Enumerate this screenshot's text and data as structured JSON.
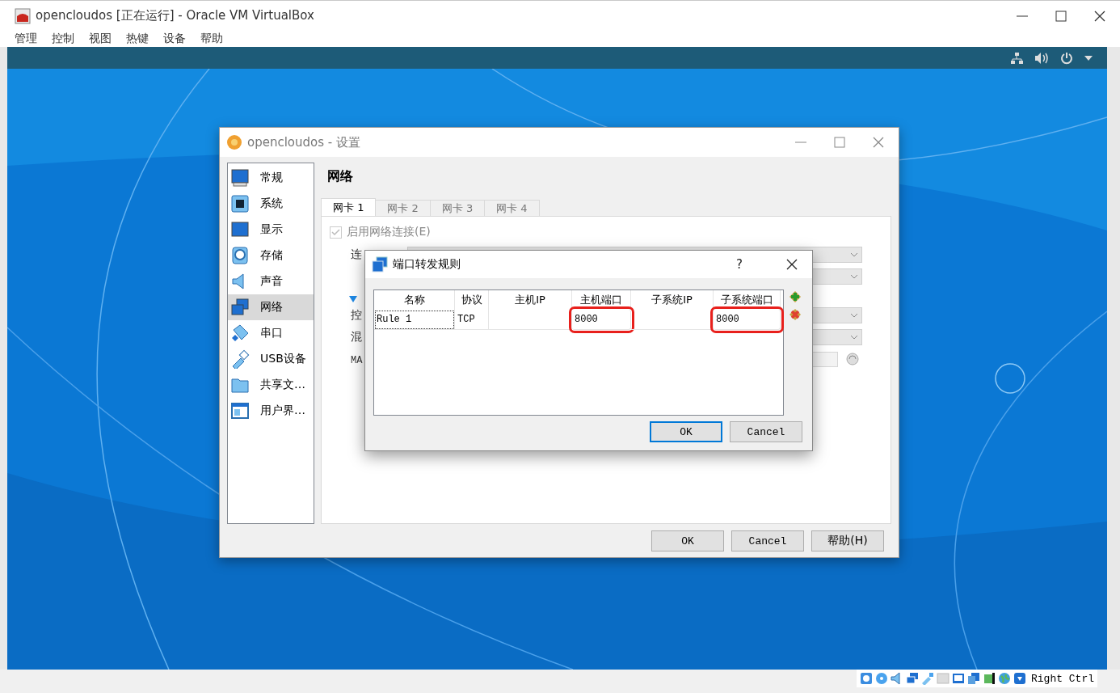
{
  "window": {
    "title": "opencloudos [正在运行] - Oracle VM VirtualBox"
  },
  "menu": [
    "管理",
    "控制",
    "视图",
    "热键",
    "设备",
    "帮助"
  ],
  "settings_dialog": {
    "title": "opencloudos - 设置",
    "sidebar": [
      {
        "label": "常规",
        "selected": false
      },
      {
        "label": "系统",
        "selected": false
      },
      {
        "label": "显示",
        "selected": false
      },
      {
        "label": "存储",
        "selected": false
      },
      {
        "label": "声音",
        "selected": false
      },
      {
        "label": "网络",
        "selected": true
      },
      {
        "label": "串口",
        "selected": false
      },
      {
        "label": "USB设备",
        "selected": false
      },
      {
        "label": "共享文…",
        "selected": false
      },
      {
        "label": "用户界…",
        "selected": false
      }
    ],
    "heading": "网络",
    "tabs": [
      {
        "label": "网卡 1",
        "selected": true
      },
      {
        "label": "网卡 2",
        "selected": false
      },
      {
        "label": "网卡 3",
        "selected": false
      },
      {
        "label": "网卡 4",
        "selected": false
      }
    ],
    "enable_checkbox": {
      "label": "启用网络连接(E)",
      "checked": true,
      "disabled": true
    },
    "rows": [
      {
        "kind": "combo",
        "label": "连"
      },
      {
        "kind": "combo"
      },
      {
        "kind": "expander"
      },
      {
        "kind": "combo",
        "label": "控"
      },
      {
        "kind": "combo",
        "label": "混"
      },
      {
        "kind": "mac",
        "label": "MA"
      }
    ],
    "buttons": [
      "OK",
      "Cancel",
      "帮助(H)"
    ]
  },
  "port_forwarding_dialog": {
    "title": "端口转发规则",
    "help": "?",
    "columns": [
      "名称",
      "协议",
      "主机IP",
      "主机端口",
      "子系统IP",
      "子系统端口"
    ],
    "rows": [
      {
        "cells": [
          {
            "text": "Rule 1",
            "focused": true,
            "highlighted": false
          },
          {
            "text": "TCP",
            "focused": false,
            "highlighted": false
          },
          {
            "focused": false,
            "highlighted": false
          },
          {
            "text": "8000",
            "focused": false,
            "highlighted": true
          },
          {
            "focused": false,
            "highlighted": false
          },
          {
            "text": "8000",
            "focused": false,
            "highlighted": true
          }
        ]
      }
    ],
    "buttons": [
      {
        "label": "OK",
        "default": true
      },
      {
        "label": "Cancel",
        "default": false
      }
    ]
  },
  "status_bar": {
    "host_key": "Right Ctrl"
  }
}
